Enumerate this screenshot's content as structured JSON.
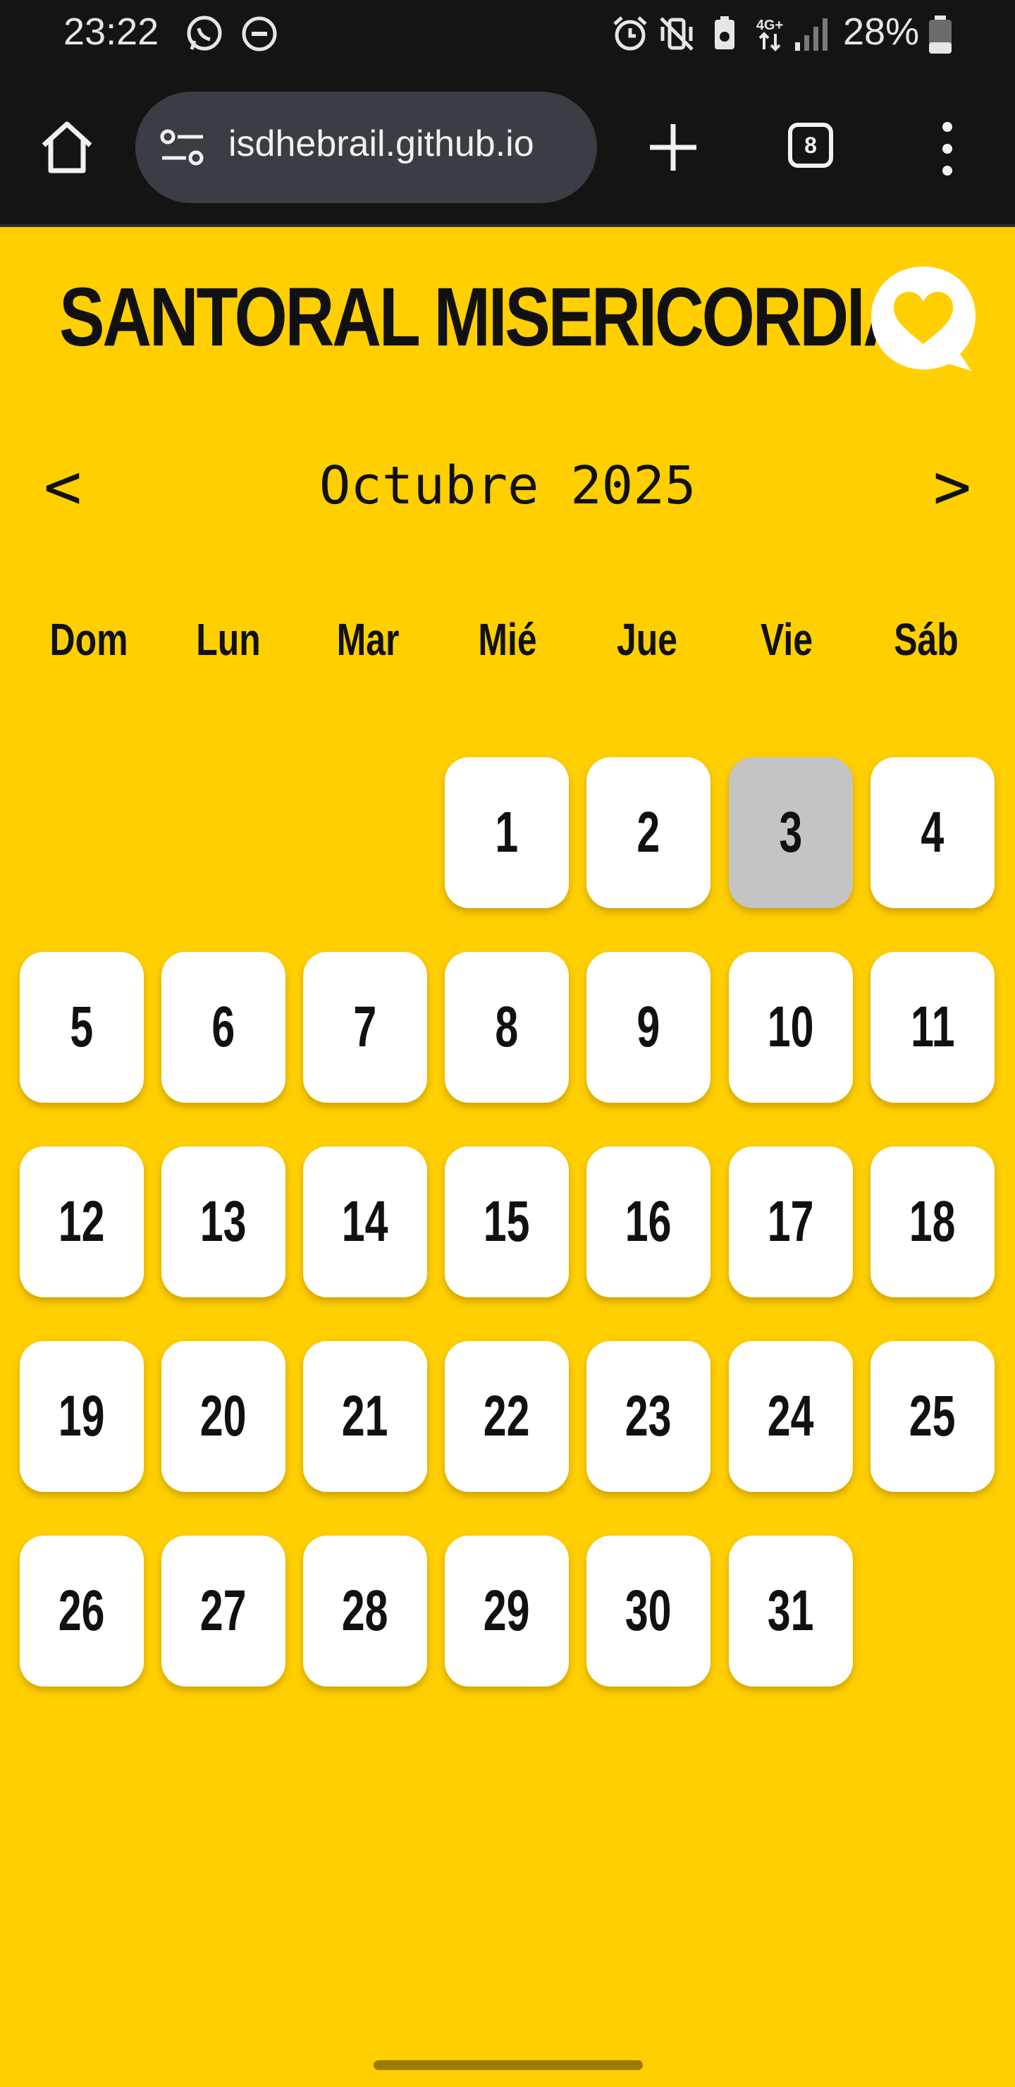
{
  "status_bar": {
    "time": "23:22",
    "battery": "28%",
    "icons": [
      "whatsapp-icon",
      "do-not-disturb-icon",
      "alarm-icon",
      "vibrate-icon",
      "battery-saver-icon",
      "4g-icon",
      "signal-icon",
      "battery-icon"
    ]
  },
  "browser": {
    "url": "isdhebrail.github.io",
    "tab_count": "8"
  },
  "page": {
    "title": "SANTORAL MISERICORDIA",
    "month_label": "Octubre 2025",
    "prev_label": "<",
    "next_label": ">",
    "accent_color": "#ffcf00",
    "today_color": "#c4c4c4"
  },
  "weekdays": [
    "Dom",
    "Lun",
    "Mar",
    "Mié",
    "Jue",
    "Vie",
    "Sáb"
  ],
  "calendar": {
    "first_weekday_index": 3,
    "days_in_month": 31,
    "selected_day": 3
  }
}
